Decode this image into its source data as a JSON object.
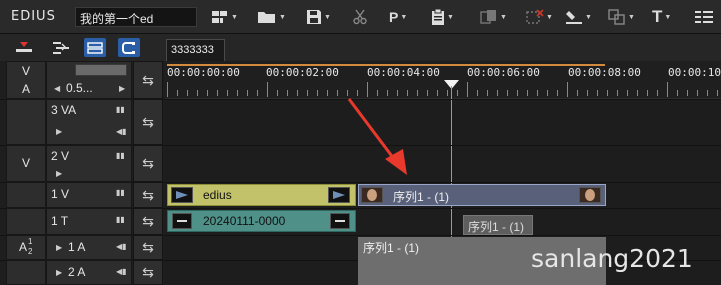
{
  "app": {
    "logo": "EDIUS",
    "project_name": "我的第一个ed"
  },
  "toolbar": {
    "p_label": "P",
    "t_label": "T"
  },
  "sequence_tab": "3333333",
  "ruler": {
    "timecodes": [
      "00:00:00:00",
      "00:00:02:00",
      "00:00:04:00",
      "00:00:06:00",
      "00:00:08:00",
      "00:00:10:"
    ]
  },
  "header": {
    "v_label": "V",
    "a_label": "A",
    "zoom_label": "0.5..."
  },
  "tracks": {
    "t3va": {
      "name": "3 VA"
    },
    "t2v": {
      "group": "V",
      "name": "2 V"
    },
    "t1v": {
      "name": "1 V"
    },
    "t1t": {
      "name": "1 T"
    },
    "t1a": {
      "group": "A",
      "name": "1 A"
    },
    "t2a": {
      "name": "2 A"
    }
  },
  "clips": {
    "edius": "edius",
    "seq_video": "序列1 - (1)",
    "title": "20240111-0000",
    "seq_audio": "序列1 - (1)",
    "ghost": "序列1 - (1)"
  },
  "watermark": "sanlang2021",
  "colors": {
    "accent": "#d28a3c",
    "playhead": "#4db6c7",
    "arrow": "#e8392c",
    "yellow_clip": "#c2c26a",
    "teal_clip": "#4f9088"
  }
}
